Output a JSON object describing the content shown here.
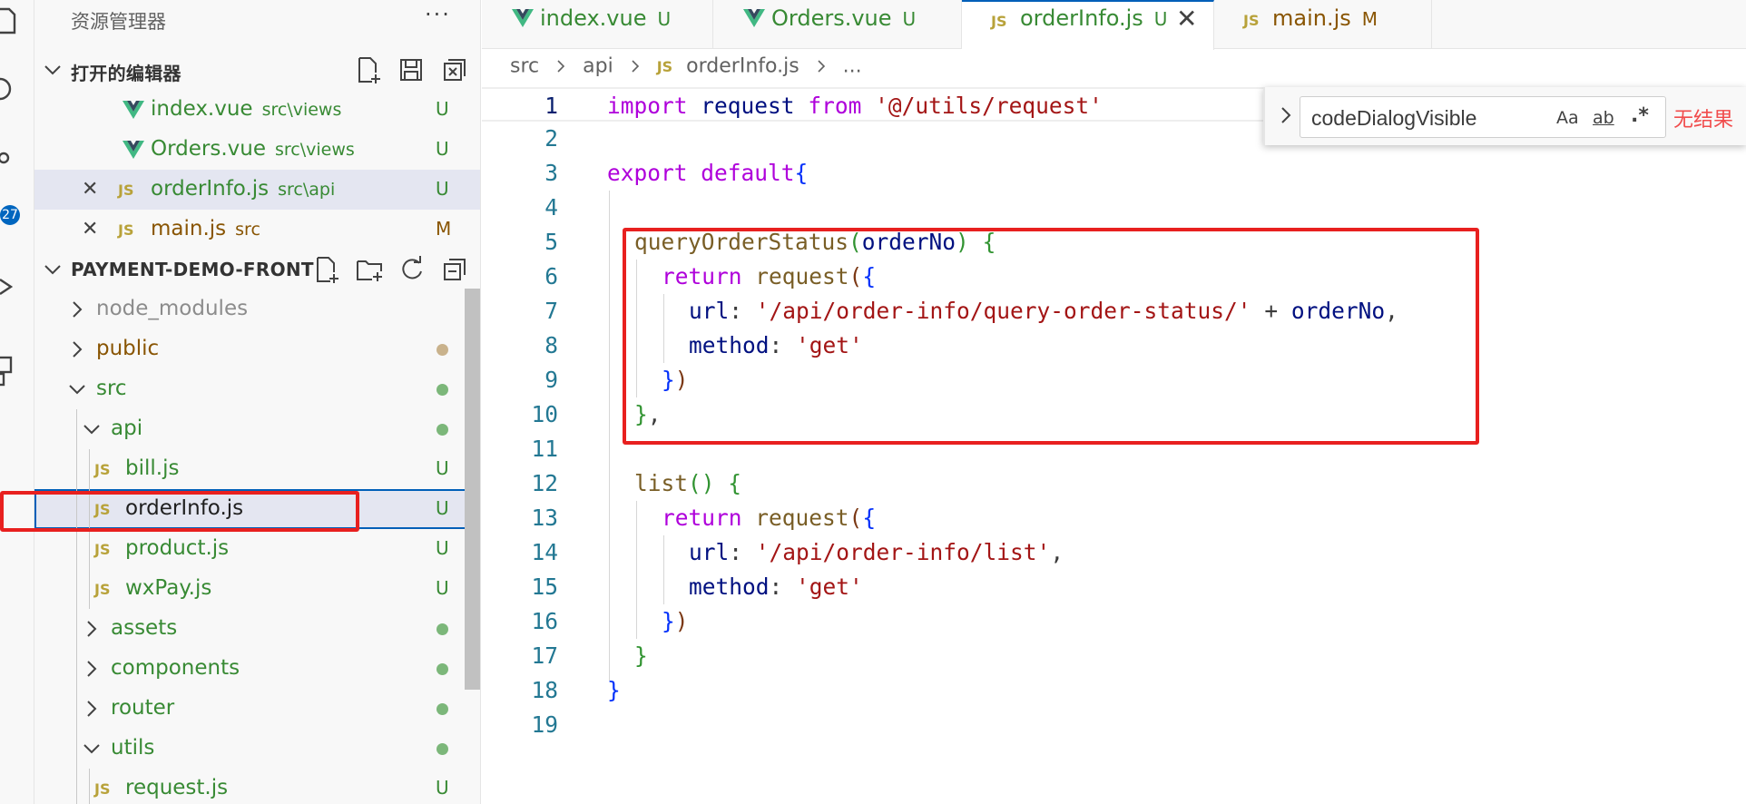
{
  "activity_bar": {
    "icons": [
      "files-icon",
      "search-icon",
      "source-control-icon",
      "run-debug-icon",
      "extensions-icon"
    ],
    "scm_badge": "27"
  },
  "sidebar": {
    "title": "资源管理器",
    "more": "···",
    "open_editors": {
      "title": "打开的编辑器",
      "items": [
        {
          "name": "index.vue",
          "path": "src\\views",
          "status": "U",
          "type": "vue"
        },
        {
          "name": "Orders.vue",
          "path": "src\\views",
          "status": "U",
          "type": "vue"
        },
        {
          "name": "orderInfo.js",
          "path": "src\\api",
          "status": "U",
          "type": "js"
        },
        {
          "name": "main.js",
          "path": "src",
          "status": "M",
          "type": "js"
        }
      ]
    },
    "project": {
      "title": "PAYMENT-DEMO-FRONT",
      "tree": [
        {
          "name": "node_modules",
          "kind": "folder",
          "open": false
        },
        {
          "name": "public",
          "kind": "folder",
          "open": false
        },
        {
          "name": "src",
          "kind": "folder",
          "open": true
        },
        {
          "name": "api",
          "kind": "folder",
          "open": true
        },
        {
          "name": "bill.js",
          "kind": "file",
          "status": "U"
        },
        {
          "name": "orderInfo.js",
          "kind": "file",
          "status": "U"
        },
        {
          "name": "product.js",
          "kind": "file",
          "status": "U"
        },
        {
          "name": "wxPay.js",
          "kind": "file",
          "status": "U"
        },
        {
          "name": "assets",
          "kind": "folder",
          "open": false
        },
        {
          "name": "components",
          "kind": "folder",
          "open": false
        },
        {
          "name": "router",
          "kind": "folder",
          "open": false
        },
        {
          "name": "utils",
          "kind": "folder",
          "open": true
        },
        {
          "name": "request.js",
          "kind": "file",
          "status": "U"
        }
      ]
    }
  },
  "tabs": [
    {
      "label": "index.vue",
      "status": "U",
      "type": "vue"
    },
    {
      "label": "Orders.vue",
      "status": "U",
      "type": "vue"
    },
    {
      "label": "orderInfo.js",
      "status": "U",
      "type": "js",
      "active": true
    },
    {
      "label": "main.js",
      "status": "M",
      "type": "js"
    }
  ],
  "breadcrumb": [
    "src",
    "api",
    "orderInfo.js",
    "..."
  ],
  "file_type_label": "JS",
  "close_glyph": "✕",
  "editor": {
    "line_numbers": [
      "1",
      "2",
      "3",
      "4",
      "5",
      "6",
      "7",
      "8",
      "9",
      "10",
      "11",
      "12",
      "13",
      "14",
      "15",
      "16",
      "17",
      "18",
      "19"
    ],
    "lines": [
      "import request from '@/utils/request'",
      "",
      "export default{",
      "",
      "  queryOrderStatus(orderNo) {",
      "    return request({",
      "      url: '/api/order-info/query-order-status/' + orderNo,",
      "      method: 'get'",
      "    })",
      "  },",
      "",
      "  list() {",
      "    return request({",
      "      url: '/api/order-info/list',",
      "      method: 'get'",
      "    })",
      "  }",
      "}",
      ""
    ]
  },
  "find_widget": {
    "query": "codeDialogVisible",
    "match_case": "Aa",
    "whole_word": "ab",
    "regex": ".*",
    "result": "无结果"
  },
  "colors": {
    "accent": "#005fb8",
    "highlight": "#e8201f",
    "git_untracked": "#388a34",
    "git_modified": "#895503"
  }
}
